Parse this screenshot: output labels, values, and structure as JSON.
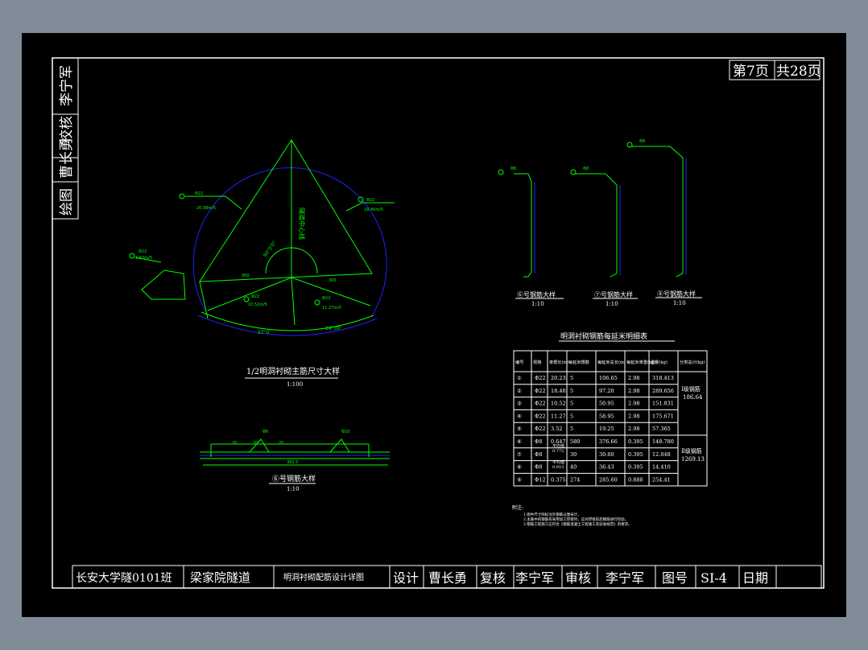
{
  "page": {
    "current": "第7页",
    "total": "共28页"
  },
  "side_strip": [
    "绘图",
    "曹长勇",
    "校核",
    "李宁军"
  ],
  "main_figure": {
    "title": "1/2明洞衬砌主筋尺寸大样",
    "scale": "1:100",
    "center_label": "隧道中心线",
    "labels": {
      "l1_code": "Φ22",
      "l1_value": "20.08m/5",
      "l2_code": "Φ22",
      "l2_value": "18.40m/5",
      "l3_code": "Φ22",
      "l3_value": "10.52m/5",
      "l4_code": "Φ22",
      "l4_value": "11.27m/5",
      "l5_code": "Φ22",
      "l5_value": "3.52m/5",
      "dim1": "300",
      "dim2": "300",
      "arc1": "27°0'",
      "arc2": "24°30'",
      "angle": "90°0'0\""
    }
  },
  "detail_fig": {
    "title": "⑥号钢筋大样",
    "scale": "1:10",
    "labels": {
      "code1": "Φ8",
      "code2": "Φ10",
      "dim_a": "20",
      "dim_b": "20",
      "dim_c": "20",
      "total": "392.5"
    }
  },
  "small_figs": [
    {
      "title": "⑥号钢筋大样",
      "scale": "1:10",
      "code": "Φ8"
    },
    {
      "title": "⑦号钢筋大样",
      "scale": "1:10",
      "code": "Φ8"
    },
    {
      "title": "⑧号钢筋大样",
      "scale": "1:10",
      "code": "Φ8"
    }
  ],
  "table": {
    "title": "明洞衬砌钢筋每延米明细表",
    "headers": [
      "编号",
      "规格",
      "单根长(m)",
      "每延米根数",
      "每延米总长(m)",
      "每延米单重(kg)",
      "重量(kg)",
      "分类总计(kg)"
    ],
    "rows": [
      [
        "①",
        "Φ22",
        "20.23",
        "5",
        "106.65",
        "2.98",
        "318.413"
      ],
      [
        "②",
        "Φ22",
        "18.40",
        "5",
        "97.20",
        "2.98",
        "289.656"
      ],
      [
        "③",
        "Φ22",
        "10.52",
        "5",
        "50.95",
        "2.98",
        "151.831"
      ],
      [
        "④",
        "Φ22",
        "11.27",
        "5",
        "58.95",
        "2.98",
        "175.671"
      ],
      [
        "⑤",
        "Φ22",
        "3.52",
        "5",
        "19.25",
        "2.98",
        "57.365"
      ],
      [
        "⑥",
        "Φ8",
        "0.647",
        "580",
        "376.66",
        "0.395",
        "148.780"
      ],
      [
        "⑦",
        "Φ8",
        "",
        "30",
        "30.60",
        "0.395",
        "12.048"
      ],
      [
        "⑧",
        "Φ8",
        "",
        "40",
        "36.43",
        "0.395",
        "14.410"
      ],
      [
        "⑨",
        "Φ12",
        "0.375",
        "274",
        "285.60",
        "0.888",
        "254.41"
      ]
    ],
    "sub_labels": [
      "平均值",
      "0.772",
      "平均值",
      "0.913"
    ],
    "group1_label": "Ⅰ级钢筋",
    "group1_value": "186.64",
    "group2_label": "Ⅱ级钢筋",
    "group2_value": "1269.13"
  },
  "notes": {
    "title": "附注:",
    "lines": [
      "1.图中尺寸除标注外钢筋以厘米计。",
      "2.主筋中的钢筋有采用加工焊接时，应对焊接前后钢筋进行检验。",
      "3.钢筋工程施工应符合《钢筋混凝土工程施工及验收规范》的要求。"
    ]
  },
  "title_block": {
    "school": "长安大学隧0101班",
    "project": "梁家院隧道",
    "drawing_name": "明洞衬砌配筋设计详图",
    "design_label": "设计",
    "designer": "曹长勇",
    "review_label": "复核",
    "reviewer": "李宁军",
    "approve_label": "审核",
    "approver": "李宁军",
    "drawing_no_label": "图号",
    "drawing_no": "SI-4",
    "date_label": "日期",
    "date": ""
  },
  "colors": {
    "background": "#808d99",
    "sheet": "#000000",
    "frame": "#ffffff",
    "rebar": "#00ff00",
    "contour": "#0000ff"
  }
}
